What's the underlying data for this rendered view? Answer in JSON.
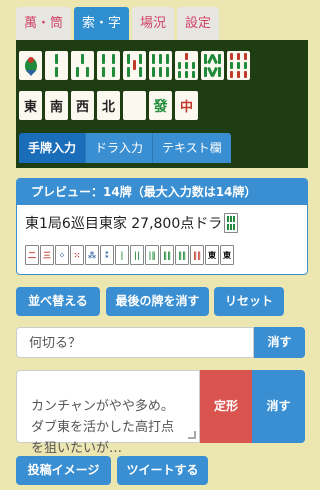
{
  "category_tabs": [
    "萬・筒",
    "索・字",
    "場況",
    "設定"
  ],
  "active_category": 1,
  "tiles_row1_bamboo": [
    "1索",
    "2索",
    "3索",
    "4索",
    "5索",
    "6索",
    "7索",
    "8索",
    "9索"
  ],
  "tiles_row2_honor": [
    "東",
    "南",
    "西",
    "北",
    "白",
    "發",
    "中"
  ],
  "mode_tabs": [
    "手牌入力",
    "ドラ入力",
    "テキスト欄"
  ],
  "active_mode": 0,
  "preview": {
    "header": "プレビュー：14牌（最大入力数は14牌）",
    "situation": "東1局6巡目東家 27,800点ドラ",
    "dora_tile": "8索"
  },
  "hand_tiles": [
    "2萬",
    "3萬",
    "5筒",
    "6筒",
    "8筒",
    "9筒",
    "1索",
    "2索",
    "3索",
    "4索",
    "5索",
    "7索",
    "東",
    "東"
  ],
  "buttons": {
    "sort": "並べ替える",
    "remove_last": "最後の牌を消す",
    "reset": "リセット",
    "clear1": "消す",
    "fixed": "定形",
    "clear2": "消す",
    "post_image": "投稿イメージ",
    "tweet": "ツイートする"
  },
  "question_input": {
    "placeholder": "何切る？"
  },
  "comment_text": "カンチャンがやや多め。\nダブ東を活かした高打点\nを狙いたいが…",
  "colors": {
    "background": "#ece6b0",
    "accent_blue": "#3a8fd2",
    "danger_red": "#d9534f",
    "tile_panel_green": "#1f3d12"
  }
}
